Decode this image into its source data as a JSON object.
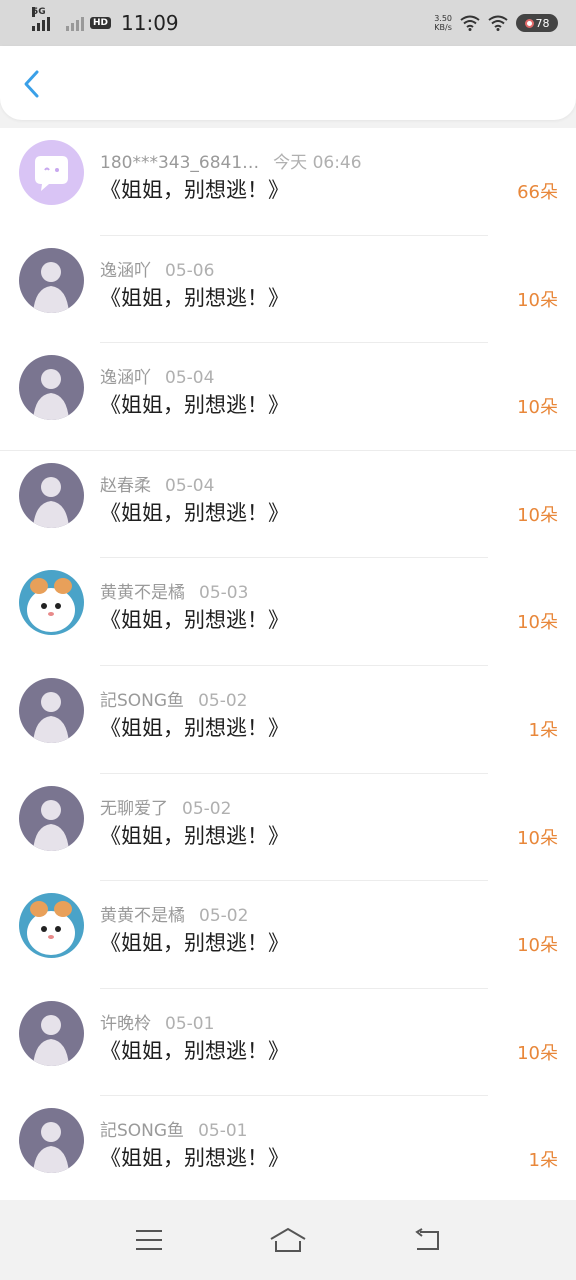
{
  "status_bar": {
    "network": "5G",
    "hd": "HD",
    "time": "11:09",
    "speed_value": "3.50",
    "speed_unit": "KB/s",
    "battery": "78"
  },
  "header": {
    "back_icon": "chevron-left-icon",
    "accent": "#3aa0e8"
  },
  "colors": {
    "count": "#e8873a",
    "meta": "#9a9a9a"
  },
  "gifts": [
    {
      "name": "180***343_6841…",
      "date": "今天 06:46",
      "title": "《姐姐，别想逃！》",
      "count": "66朵",
      "avatar": "chat-bubble-avatar"
    },
    {
      "name": "逸涵吖",
      "date": "05-06",
      "title": "《姐姐，别想逃！》",
      "count": "10朵",
      "avatar": "user-avatar"
    },
    {
      "name": "逸涵吖",
      "date": "05-04",
      "title": "《姐姐，别想逃！》",
      "count": "10朵",
      "avatar": "user-avatar"
    },
    {
      "name": "赵春柔",
      "date": "05-04",
      "title": "《姐姐，别想逃！》",
      "count": "10朵",
      "avatar": "user-avatar"
    },
    {
      "name": "黄黄不是橘",
      "date": "05-03",
      "title": "《姐姐，别想逃！》",
      "count": "10朵",
      "avatar": "cartoon-avatar"
    },
    {
      "name": "記SONG鱼",
      "date": "05-02",
      "title": "《姐姐，别想逃！》",
      "count": "1朵",
      "avatar": "user-avatar"
    },
    {
      "name": "无聊爱了",
      "date": "05-02",
      "title": "《姐姐，别想逃！》",
      "count": "10朵",
      "avatar": "user-avatar"
    },
    {
      "name": "黄黄不是橘",
      "date": "05-02",
      "title": "《姐姐，别想逃！》",
      "count": "10朵",
      "avatar": "cartoon-avatar"
    },
    {
      "name": "许晚柃",
      "date": "05-01",
      "title": "《姐姐，别想逃！》",
      "count": "10朵",
      "avatar": "user-avatar"
    },
    {
      "name": "記SONG鱼",
      "date": "05-01",
      "title": "《姐姐，别想逃！》",
      "count": "1朵",
      "avatar": "user-avatar"
    }
  ],
  "nav": {
    "menu": "menu-icon",
    "home": "home-icon",
    "back": "back-icon"
  }
}
